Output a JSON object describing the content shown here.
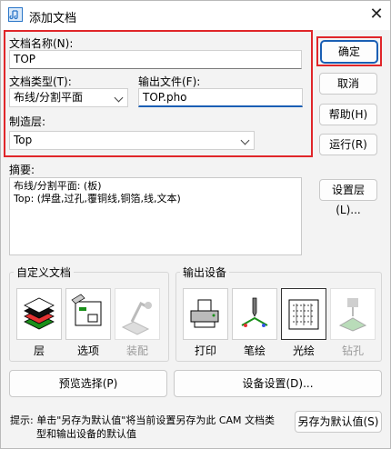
{
  "window": {
    "title": "添加文档",
    "close_glyph": "✕"
  },
  "form": {
    "doc_name_label": "文档名称(N):",
    "doc_name_value": "TOP",
    "doc_type_label": "文档类型(T):",
    "doc_type_value": "布线/分割平面",
    "output_file_label": "输出文件(F):",
    "output_file_value": "TOP.pho",
    "layer_label": "制造层:",
    "layer_value": "Top"
  },
  "buttons": {
    "ok": "确定",
    "cancel": "取消",
    "help": "帮助(H)",
    "run": "运行(R)",
    "set_layer": "设置层(L)...",
    "preview": "预览选择(P)",
    "device_setup": "设备设置(D)...",
    "save_default": "另存为默认值(S)"
  },
  "summary": {
    "label": "摘要:",
    "lines": [
      "布线/分割平面: (板)",
      "Top: (焊盘,过孔,覆铜线,铜箔,线,文本)"
    ]
  },
  "custom_doc": {
    "title": "自定义文档",
    "items": [
      {
        "label": "层",
        "icon": "layers-icon",
        "enabled": true
      },
      {
        "label": "选项",
        "icon": "options-icon",
        "enabled": true
      },
      {
        "label": "装配",
        "icon": "assembly-icon",
        "enabled": false
      }
    ]
  },
  "output_device": {
    "title": "输出设备",
    "items": [
      {
        "label": "打印",
        "icon": "printer-icon",
        "enabled": true,
        "selected": false
      },
      {
        "label": "笔绘",
        "icon": "pen-plotter-icon",
        "enabled": true,
        "selected": false
      },
      {
        "label": "光绘",
        "icon": "photo-plotter-icon",
        "enabled": true,
        "selected": true
      },
      {
        "label": "钻孔",
        "icon": "drill-icon",
        "enabled": false,
        "selected": false
      }
    ]
  },
  "hint": {
    "line1": "提示: 单击\"另存为默认值\"将当前设置另存为此 CAM 文档类",
    "line2": "型和输出设备的默认值"
  },
  "colors": {
    "highlight_red": "#e0262a",
    "accent_blue": "#1a5fb4"
  }
}
